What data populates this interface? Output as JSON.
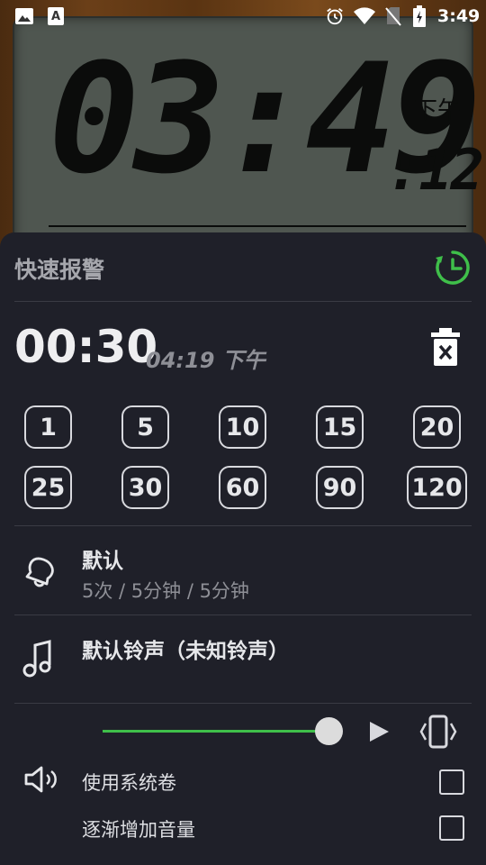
{
  "status_bar": {
    "time": "3:49",
    "icons": [
      "image-icon",
      "text-icon",
      "alarm-icon",
      "wifi-icon",
      "no-sim-icon",
      "battery-charging-icon"
    ]
  },
  "clock": {
    "time": "03:49",
    "ampm": "下午",
    "seconds": ":12"
  },
  "sheet": {
    "title": "快速报警",
    "countdown": "00:30",
    "due_time": "04:19 下午",
    "minute_options": [
      "1",
      "5",
      "10",
      "15",
      "20",
      "25",
      "30",
      "60",
      "90",
      "120"
    ],
    "snooze": {
      "title": "默认",
      "subtitle": "5次 / 5分钟 / 5分钟"
    },
    "ringtone": {
      "title": "默认铃声（未知铃声）"
    },
    "volume_level": 0.93,
    "options": [
      {
        "label": "使用系统卷",
        "checked": false
      },
      {
        "label": "逐渐增加音量",
        "checked": false
      }
    ]
  },
  "colors": {
    "accent": "#3fbf4a",
    "sheet_bg": "#1f2029",
    "lcd_bg": "#4f5650"
  }
}
